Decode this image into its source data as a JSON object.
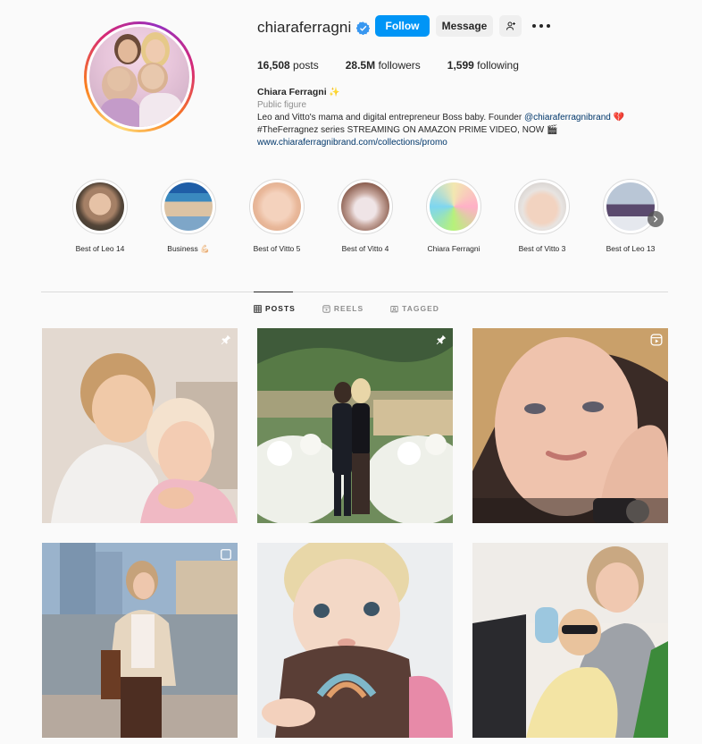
{
  "profile": {
    "username": "chiaraferragni",
    "verified": true,
    "follow_label": "Follow",
    "message_label": "Message",
    "stats": {
      "posts_count": "16,508",
      "posts_label": "posts",
      "followers_count": "28.5M",
      "followers_label": "followers",
      "following_count": "1,599",
      "following_label": "following"
    },
    "bio": {
      "name": "Chiara Ferragni",
      "name_emoji": "✨",
      "category": "Public figure",
      "line1_prefix": "Leo and Vitto's mama and digital entrepreneur Boss baby. Founder ",
      "line1_mention": "@chiaraferragnibrand",
      "line1_emoji": "💔",
      "line2": "#TheFerragnez series STREAMING ON AMAZON PRIME VIDEO, NOW 🎬",
      "link": "www.chiaraferragnibrand.com/collections/promo"
    }
  },
  "highlights": [
    {
      "label": "Best of Leo 14"
    },
    {
      "label": "Business 💪🏻"
    },
    {
      "label": "Best of Vitto 5"
    },
    {
      "label": "Best of Vitto 4"
    },
    {
      "label": "Chiara Ferragni"
    },
    {
      "label": "Best of Vitto 3"
    },
    {
      "label": "Best of Leo 13"
    }
  ],
  "tabs": {
    "posts": "POSTS",
    "reels": "REELS",
    "tagged": "TAGGED"
  },
  "icons": {
    "verified": "verified-badge-icon",
    "add_user": "add-user-icon",
    "more": "more-options-icon",
    "pin": "pin-icon",
    "reel": "reel-icon",
    "grid": "grid-icon",
    "tagged": "tagged-icon",
    "next": "chevron-right-icon"
  },
  "colors": {
    "accent": "#0095f6",
    "link": "#00376b",
    "muted": "#8e8e8e",
    "background": "#fafafa"
  }
}
